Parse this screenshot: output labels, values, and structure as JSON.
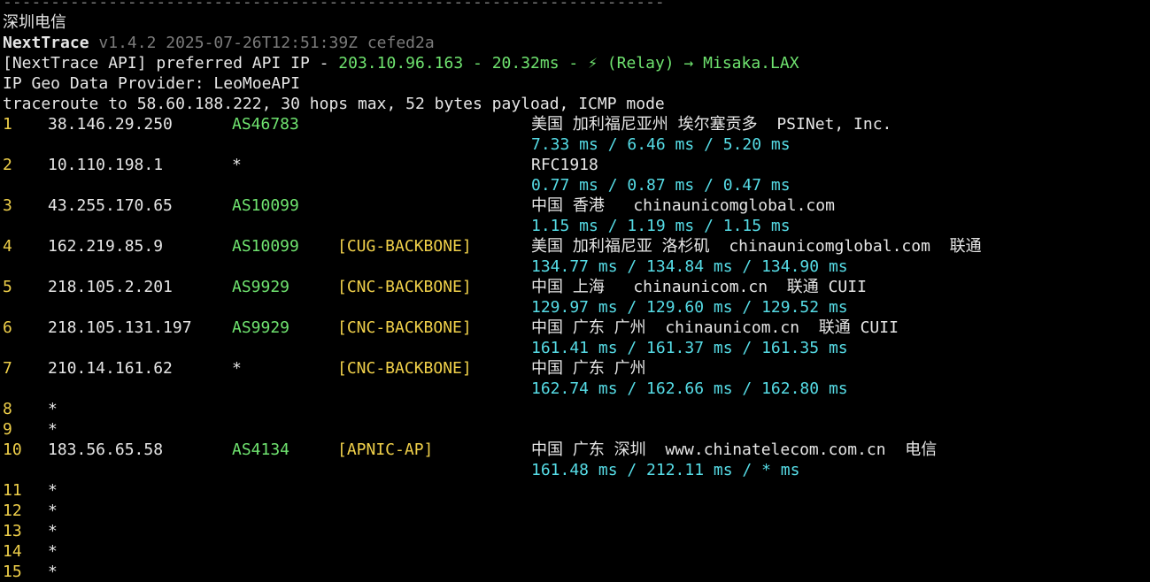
{
  "header": {
    "dash_line": "---------------------------------------------------------------------",
    "title_cn": "深圳电信",
    "app_name": "NextTrace",
    "app_version": "v1.4.2 2025-07-26T12:51:39Z cefed2a",
    "api_prefix": "[NextTrace API] preferred API IP - ",
    "api_ip": "203.10.96.163",
    "api_sep1": " - ",
    "api_latency": "20.32ms",
    "api_sep2": " - ",
    "api_relay": "(Relay) ",
    "api_arrow": "→ ",
    "api_node": "Misaka.LAX",
    "geo_provider": "IP Geo Data Provider: LeoMoeAPI",
    "traceroute_info": "traceroute to 58.60.188.222, 30 hops max, 52 bytes payload, ICMP mode"
  },
  "hops": [
    {
      "hop": "1",
      "ip": "38.146.29.250",
      "asn": "AS46783",
      "tag": "",
      "geo": "美国 加利福尼亚州 埃尔塞贡多  PSINet, Inc.",
      "rtt": "7.33 ms / 6.46 ms / 5.20 ms"
    },
    {
      "hop": "2",
      "ip": "10.110.198.1",
      "star": "*",
      "tag": "",
      "geo": "RFC1918",
      "rtt": "0.77 ms / 0.87 ms / 0.47 ms"
    },
    {
      "hop": "3",
      "ip": "43.255.170.65",
      "asn": "AS10099",
      "tag": "",
      "geo": "中国 香港   chinaunicomglobal.com",
      "rtt": "1.15 ms / 1.19 ms / 1.15 ms"
    },
    {
      "hop": "4",
      "ip": "162.219.85.9",
      "asn": "AS10099",
      "tag": "[CUG-BACKBONE]",
      "geo": "美国 加利福尼亚 洛杉矶  chinaunicomglobal.com  联通",
      "rtt": "134.77 ms / 134.84 ms / 134.90 ms"
    },
    {
      "hop": "5",
      "ip": "218.105.2.201",
      "asn": "AS9929",
      "tag": "[CNC-BACKBONE]",
      "geo": "中国 上海   chinaunicom.cn  联通 CUII",
      "rtt": "129.97 ms / 129.60 ms / 129.52 ms"
    },
    {
      "hop": "6",
      "ip": "218.105.131.197",
      "asn": "AS9929",
      "tag": "[CNC-BACKBONE]",
      "geo": "中国 广东 广州  chinaunicom.cn  联通 CUII",
      "rtt": "161.41 ms / 161.37 ms / 161.35 ms"
    },
    {
      "hop": "7",
      "ip": "210.14.161.62",
      "star": "*",
      "tag": "[CNC-BACKBONE]",
      "geo": "中国 广东 广州",
      "rtt": "162.74 ms / 162.66 ms / 162.80 ms"
    }
  ],
  "timeouts_a": [
    {
      "hop": "8",
      "star": "*"
    },
    {
      "hop": "9",
      "star": "*"
    }
  ],
  "hop10": {
    "hop": "10",
    "ip": "183.56.65.58",
    "asn": "AS4134",
    "tag": "[APNIC-AP]",
    "geo": "中国 广东 深圳  www.chinatelecom.com.cn  电信",
    "rtt": "161.48 ms / 212.11 ms / * ms"
  },
  "timeouts_b": [
    {
      "hop": "11",
      "star": "*"
    },
    {
      "hop": "12",
      "star": "*"
    },
    {
      "hop": "13",
      "star": "*"
    },
    {
      "hop": "14",
      "star": "*"
    },
    {
      "hop": "15",
      "star": "*"
    }
  ],
  "colors": {
    "background": "#000000",
    "text": "#e6e6e6",
    "hop": "#f0d04a",
    "asn": "#6fe36f",
    "rtt": "#56dce6",
    "dim": "#7b7b7b"
  }
}
